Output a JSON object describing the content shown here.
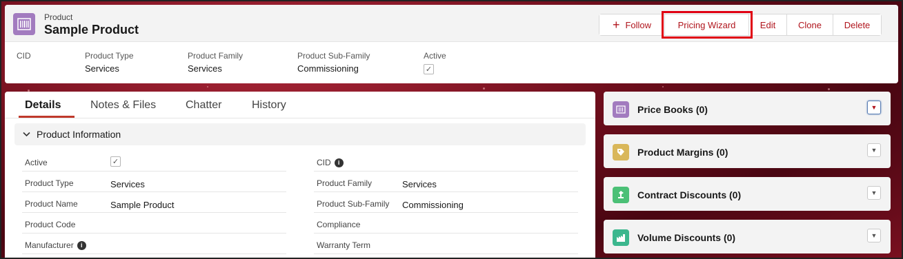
{
  "header": {
    "object_label": "Product",
    "record_title": "Sample Product",
    "icon": "product-barcode-icon",
    "actions": {
      "follow": "Follow",
      "pricing_wizard": "Pricing Wizard",
      "edit": "Edit",
      "clone": "Clone",
      "delete": "Delete"
    },
    "highlights": {
      "cid_label": "CID",
      "product_type_label": "Product Type",
      "product_type_value": "Services",
      "product_family_label": "Product Family",
      "product_family_value": "Services",
      "product_subfamily_label": "Product Sub-Family",
      "product_subfamily_value": "Commissioning",
      "active_label": "Active",
      "active_checked": true
    }
  },
  "tabs": [
    "Details",
    "Notes & Files",
    "Chatter",
    "History"
  ],
  "section": {
    "title": "Product Information"
  },
  "fields": {
    "active_label": "Active",
    "product_type_label": "Product Type",
    "product_type_value": "Services",
    "product_name_label": "Product Name",
    "product_name_value": "Sample Product",
    "product_code_label": "Product Code",
    "manufacturer_label": "Manufacturer",
    "cid_label": "CID",
    "product_family_label": "Product Family",
    "product_family_value": "Services",
    "product_subfamily_label": "Product Sub-Family",
    "product_subfamily_value": "Commissioning",
    "compliance_label": "Compliance",
    "warranty_term_label": "Warranty Term"
  },
  "related_lists": [
    {
      "title": "Price Books (0)",
      "icon": "price-book-icon",
      "color": "#a27bbf"
    },
    {
      "title": "Product Margins (0)",
      "icon": "margins-icon",
      "color": "#d9b75a"
    },
    {
      "title": "Contract Discounts (0)",
      "icon": "contract-icon",
      "color": "#4bc076"
    },
    {
      "title": "Volume Discounts (0)",
      "icon": "volume-icon",
      "color": "#3cb78e"
    }
  ]
}
